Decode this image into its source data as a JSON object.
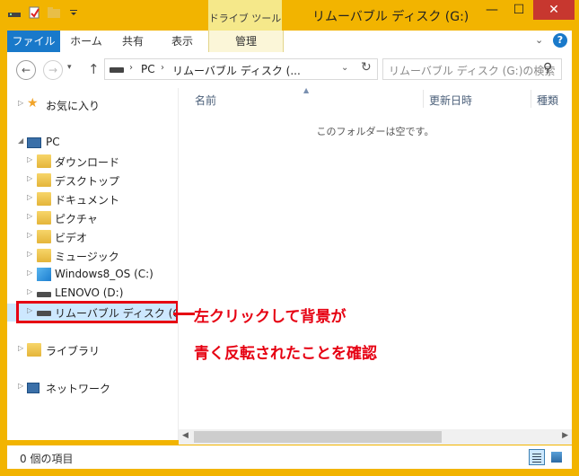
{
  "window": {
    "title": "リムーバブル ディスク (G:)",
    "context_group": "ドライブ ツール",
    "controls": {
      "minimize": "—",
      "maximize": "☐",
      "close": "✕"
    }
  },
  "ribbon": {
    "tabs": {
      "file": "ファイル",
      "home": "ホーム",
      "share": "共有",
      "view": "表示",
      "manage": "管理"
    },
    "help": "?",
    "expand": "⌄"
  },
  "nav": {
    "back": "←",
    "forward": "→",
    "recent": "▾",
    "up": "↑",
    "address": {
      "pc": "PC",
      "drive": "リムーバブル ディスク (...",
      "separator": "›",
      "dropdown": "⌄",
      "refresh": "↻"
    },
    "search_placeholder": "リムーバブル ディスク (G:)の検索"
  },
  "tree": {
    "favorites": "お気に入り",
    "pc": "PC",
    "downloads": "ダウンロード",
    "desktop": "デスクトップ",
    "documents": "ドキュメント",
    "pictures": "ピクチャ",
    "videos": "ビデオ",
    "music": "ミュージック",
    "windows_os": "Windows8_OS (C:)",
    "lenovo": "LENOVO (D:)",
    "removable": "リムーバブル ディスク (G:)",
    "libraries": "ライブラリ",
    "network": "ネットワーク",
    "arrow_collapsed": "▷",
    "arrow_expanded": "◢"
  },
  "content": {
    "columns": {
      "name": "名前",
      "modified": "更新日時",
      "type": "種類"
    },
    "empty_message": "このフォルダーは空です。"
  },
  "annotation": {
    "line1": "左クリックして背景が",
    "line2": "青く反転されたことを確認",
    "color": "#E60012"
  },
  "status": {
    "item_count": "0 個の項目"
  },
  "colors": {
    "frame": "#F2B400",
    "accent": "#1979CA",
    "selection": "#CDE8FF"
  }
}
